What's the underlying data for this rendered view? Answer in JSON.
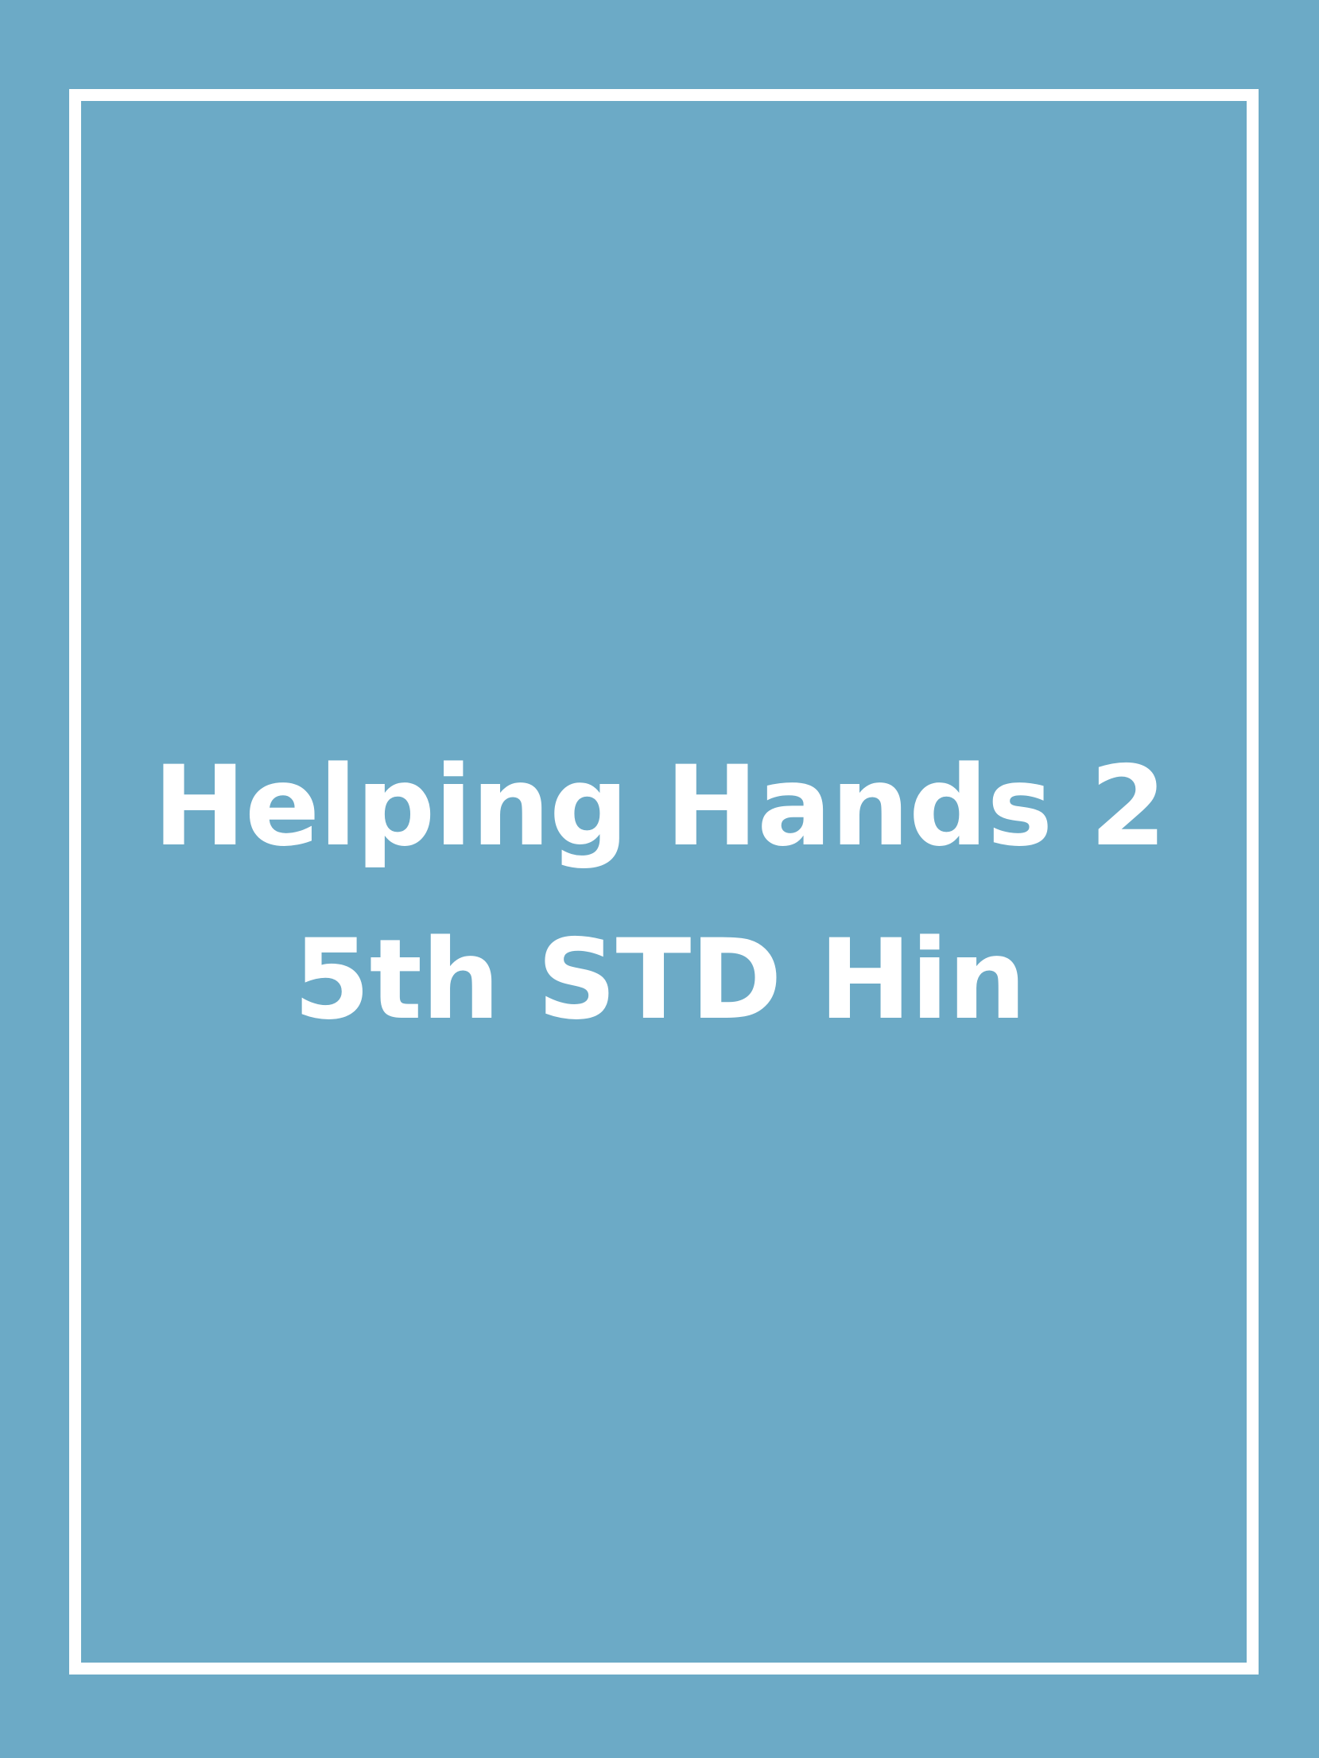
{
  "cover": {
    "background_color": "#6caac6",
    "border_color": "#ffffff",
    "text_color": "#ffffff",
    "title_lines": [
      "Helping Hands 2",
      "5th STD Hin"
    ]
  }
}
